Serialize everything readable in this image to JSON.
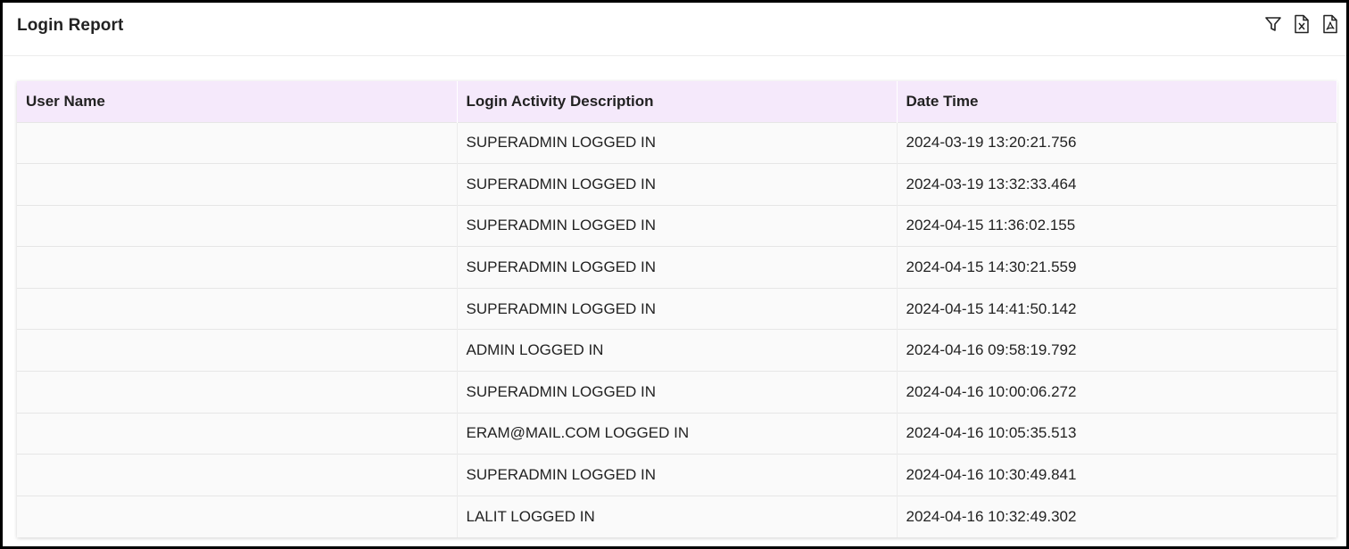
{
  "header": {
    "title": "Login Report",
    "actions": [
      {
        "icon": "filter-icon"
      },
      {
        "icon": "excel-export-icon"
      },
      {
        "icon": "pdf-export-icon"
      }
    ]
  },
  "table": {
    "columns": [
      "User Name",
      "Login Activity Description",
      "Date Time"
    ],
    "rows": [
      {
        "user": "",
        "description": "SUPERADMIN LOGGED IN",
        "datetime": "2024-03-19 13:20:21.756"
      },
      {
        "user": "",
        "description": "SUPERADMIN LOGGED IN",
        "datetime": "2024-03-19 13:32:33.464"
      },
      {
        "user": "",
        "description": "SUPERADMIN LOGGED IN",
        "datetime": "2024-04-15 11:36:02.155"
      },
      {
        "user": "",
        "description": "SUPERADMIN LOGGED IN",
        "datetime": "2024-04-15 14:30:21.559"
      },
      {
        "user": "",
        "description": "SUPERADMIN LOGGED IN",
        "datetime": "2024-04-15 14:41:50.142"
      },
      {
        "user": "",
        "description": "ADMIN LOGGED IN",
        "datetime": "2024-04-16 09:58:19.792"
      },
      {
        "user": "",
        "description": "SUPERADMIN LOGGED IN",
        "datetime": "2024-04-16 10:00:06.272"
      },
      {
        "user": "",
        "description": "ERAM@MAIL.COM LOGGED IN",
        "datetime": "2024-04-16 10:05:35.513"
      },
      {
        "user": "",
        "description": "SUPERADMIN LOGGED IN",
        "datetime": "2024-04-16 10:30:49.841"
      },
      {
        "user": "",
        "description": "LALIT LOGGED IN",
        "datetime": "2024-04-16 10:32:49.302"
      }
    ]
  },
  "colors": {
    "header_row_bg": "#f5e9fb",
    "row_bg": "#fafafa",
    "frame_border": "#000000"
  }
}
